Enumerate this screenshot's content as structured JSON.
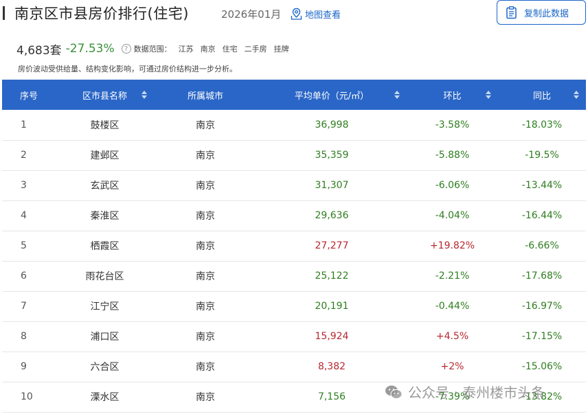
{
  "header": {
    "title": "南京区市县房价排行(住宅)",
    "date": "2026年01月",
    "map_link": "地图查看",
    "copy_button": "复制此数据"
  },
  "summary": {
    "count": "4,683套",
    "change": "-27.53%",
    "help": "?",
    "scope_label": "数据范围：",
    "scope_items": [
      "江苏",
      "南京",
      "住宅",
      "二手房",
      "挂牌"
    ],
    "note": "房价波动受供给量、结构变化影响，可通过房价结构进一步分析。"
  },
  "table": {
    "headers": [
      "序号",
      "区市县名称",
      "所属城市",
      "平均单价（元/㎡）",
      "环比",
      "同比"
    ],
    "rows": [
      {
        "idx": "1",
        "district": "鼓楼区",
        "city": "南京",
        "price": "36,998",
        "mom": "-3.58%",
        "yoy": "-18.03%",
        "price_color": "green",
        "mom_color": "green",
        "yoy_color": "green"
      },
      {
        "idx": "2",
        "district": "建邺区",
        "city": "南京",
        "price": "35,359",
        "mom": "-5.88%",
        "yoy": "-19.5%",
        "price_color": "green",
        "mom_color": "green",
        "yoy_color": "green"
      },
      {
        "idx": "3",
        "district": "玄武区",
        "city": "南京",
        "price": "31,307",
        "mom": "-6.06%",
        "yoy": "-13.44%",
        "price_color": "green",
        "mom_color": "green",
        "yoy_color": "green"
      },
      {
        "idx": "4",
        "district": "秦淮区",
        "city": "南京",
        "price": "29,636",
        "mom": "-4.04%",
        "yoy": "-16.44%",
        "price_color": "green",
        "mom_color": "green",
        "yoy_color": "green"
      },
      {
        "idx": "5",
        "district": "栖霞区",
        "city": "南京",
        "price": "27,277",
        "mom": "+19.82%",
        "yoy": "-6.66%",
        "price_color": "red",
        "mom_color": "red",
        "yoy_color": "green"
      },
      {
        "idx": "6",
        "district": "雨花台区",
        "city": "南京",
        "price": "25,122",
        "mom": "-2.21%",
        "yoy": "-17.68%",
        "price_color": "green",
        "mom_color": "green",
        "yoy_color": "green"
      },
      {
        "idx": "7",
        "district": "江宁区",
        "city": "南京",
        "price": "20,191",
        "mom": "-0.44%",
        "yoy": "-16.97%",
        "price_color": "green",
        "mom_color": "green",
        "yoy_color": "green"
      },
      {
        "idx": "8",
        "district": "浦口区",
        "city": "南京",
        "price": "15,924",
        "mom": "+4.5%",
        "yoy": "-17.15%",
        "price_color": "red",
        "mom_color": "red",
        "yoy_color": "green"
      },
      {
        "idx": "9",
        "district": "六合区",
        "city": "南京",
        "price": "8,382",
        "mom": "+2%",
        "yoy": "-15.06%",
        "price_color": "red",
        "mom_color": "red",
        "yoy_color": "green"
      },
      {
        "idx": "10",
        "district": "溧水区",
        "city": "南京",
        "price": "7,156",
        "mom": "-7.39%",
        "yoy": "-13.82%",
        "price_color": "green",
        "mom_color": "green",
        "yoy_color": "green"
      }
    ]
  },
  "watermark": {
    "text": "公众号 · 泰州楼市头条"
  },
  "colors": {
    "accent": "#2a66c7",
    "down": "#2e7d1f",
    "up": "#b8262e"
  },
  "icons": {
    "map": "map-pin-icon",
    "copy": "clipboard-icon",
    "help": "question-circle-icon",
    "sort": "sort-arrows-icon",
    "watermark": "wechat-icon"
  }
}
